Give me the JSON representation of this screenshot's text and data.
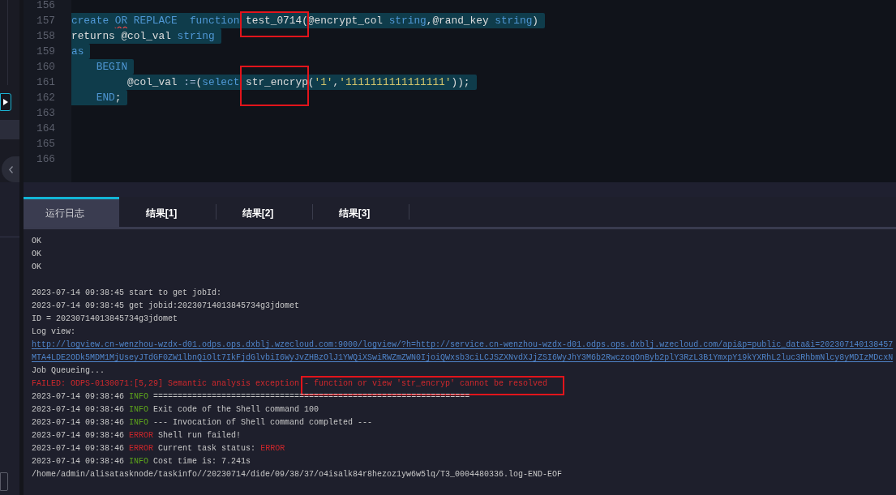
{
  "editor": {
    "lines": [
      {
        "number": "156",
        "selected": false
      },
      {
        "number": "157",
        "selected": true,
        "tokens": [
          {
            "kind": "keyword",
            "text": "create ",
            "flagged": false
          },
          {
            "kind": "keyword",
            "text": "OR",
            "flagged": true
          },
          {
            "kind": "keyword",
            "text": " REPLACE  function ",
            "flagged": false
          },
          {
            "kind": "plain",
            "text": "test_0714(@encrypt_col ",
            "flagged": false
          },
          {
            "kind": "keyword",
            "text": "string",
            "flagged": false
          },
          {
            "kind": "plain",
            "text": ",@rand_key ",
            "flagged": false
          },
          {
            "kind": "keyword",
            "text": "string",
            "flagged": false
          },
          {
            "kind": "plain",
            "text": ")",
            "flagged": false
          }
        ]
      },
      {
        "number": "158",
        "selected": true,
        "tokens": [
          {
            "kind": "plain",
            "text": "returns @col_val ",
            "flagged": false
          },
          {
            "kind": "keyword",
            "text": "string",
            "flagged": false
          }
        ]
      },
      {
        "number": "159",
        "selected": true,
        "tokens": [
          {
            "kind": "keyword",
            "text": "as",
            "flagged": false
          }
        ]
      },
      {
        "number": "160",
        "selected": true,
        "tokens": [
          {
            "kind": "keyword",
            "text": "    BEGIN",
            "flagged": false
          }
        ]
      },
      {
        "number": "161",
        "selected": true,
        "tokens": [
          {
            "kind": "plain",
            "text": "         @col_val ",
            "flagged": false
          },
          {
            "kind": "operator",
            "text": ":=",
            "flagged": false
          },
          {
            "kind": "plain",
            "text": "(",
            "flagged": false
          },
          {
            "kind": "keyword",
            "text": "select",
            "flagged": false
          },
          {
            "kind": "plain",
            "text": " str_encryp(",
            "flagged": false
          },
          {
            "kind": "string",
            "text": "'1'",
            "flagged": false
          },
          {
            "kind": "plain",
            "text": ",",
            "flagged": false
          },
          {
            "kind": "string",
            "text": "'1111111111111111'",
            "flagged": false
          },
          {
            "kind": "plain",
            "text": "));",
            "flagged": false
          }
        ]
      },
      {
        "number": "162",
        "selected": true,
        "tokens": [
          {
            "kind": "keyword",
            "text": "    END",
            "flagged": false
          },
          {
            "kind": "plain",
            "text": ";",
            "flagged": false
          }
        ]
      },
      {
        "number": "163",
        "selected": false
      },
      {
        "number": "164",
        "selected": false
      },
      {
        "number": "165",
        "selected": false
      },
      {
        "number": "166",
        "selected": false
      }
    ]
  },
  "tabs": [
    {
      "label": "运行日志",
      "selected": true
    },
    {
      "label": "结果[1]",
      "selected": false
    },
    {
      "label": "结果[2]",
      "selected": false
    },
    {
      "label": "结果[3]",
      "selected": false
    }
  ],
  "log": {
    "lines": [
      {
        "kind": "plain",
        "text": "OK"
      },
      {
        "kind": "plain",
        "text": "OK"
      },
      {
        "kind": "plain",
        "text": "OK"
      },
      {
        "kind": "blank"
      },
      {
        "kind": "plain",
        "text": "2023-07-14 09:38:45 start to get jobId:"
      },
      {
        "kind": "plain",
        "text": "2023-07-14 09:38:45 get jobid:20230714013845734g3jdomet"
      },
      {
        "kind": "plain",
        "text": "ID = 20230714013845734g3jdomet"
      },
      {
        "kind": "plain",
        "text": "Log view:"
      },
      {
        "kind": "link",
        "text": "http://logview.cn-wenzhou-wzdx-d01.odps.ops.dxblj.wzecloud.com:9000/logview/?h=http://service.cn-wenzhou-wzdx-d01.odps.ops.dxblj.wzecloud.com/api&p=public_data&i=202307140138457"
      },
      {
        "kind": "link",
        "text": "MTA4LDE2ODk5MDM1MjUseyJTdGF0ZW1lbnQiOlt7IkFjdGlvbiI6WyJvZHBzOlJ1YWQiXSwiRWZmZWN0IjoiQWxsb3ciLCJSZXNvdXJjZSI6WyJhY3M6b2RwczoqOnByb2plY3RzL3B1YmxpY19kYXRhL2luc3RhbmNlcy8yMDIzMDcxN"
      },
      {
        "kind": "plain",
        "text": "Job Queueing..."
      },
      {
        "kind": "error",
        "text": "FAILED: ODPS-0130071:[5,29] Semantic analysis exception",
        "highlighted_text": "- function or view 'str_encryp' cannot be resolved"
      },
      {
        "kind": "entry",
        "time": "2023-07-14 09:38:46",
        "level": "INFO",
        "color": "#5ea61c",
        "message": "================================================================="
      },
      {
        "kind": "entry",
        "time": "2023-07-14 09:38:46",
        "level": "INFO",
        "color": "#5ea61c",
        "message": "Exit code of the Shell command 100"
      },
      {
        "kind": "entry",
        "time": "2023-07-14 09:38:46",
        "level": "INFO",
        "color": "#5ea61c",
        "message": "--- Invocation of Shell command completed ---"
      },
      {
        "kind": "entry",
        "time": "2023-07-14 09:38:46",
        "level": "ERROR",
        "color": "#c8262b",
        "message": "Shell run failed!"
      },
      {
        "kind": "entry",
        "time": "2023-07-14 09:38:46",
        "level": "ERROR",
        "color": "#c8262b",
        "message": "Current task status:",
        "status": "ERROR"
      },
      {
        "kind": "entry",
        "time": "2023-07-14 09:38:46",
        "level": "INFO",
        "color": "#5ea61c",
        "message": "Cost time is: 7.241s"
      },
      {
        "kind": "plain",
        "text": "/home/admin/alisatasknode/taskinfo//20230714/dide/09/38/37/o4isalk84r8hezoz1yw6w5lq/T3_0004480336.log-END-EOF"
      }
    ]
  }
}
